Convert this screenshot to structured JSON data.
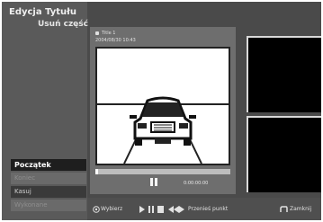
{
  "header": {
    "title": "Edycja Tytułu",
    "subtitle": "Usuń część"
  },
  "menu": {
    "items": [
      {
        "label": "Początek",
        "state": "active"
      },
      {
        "label": "Koniec",
        "state": "dim"
      },
      {
        "label": "Kasuj",
        "state": "normal"
      },
      {
        "label": "Wykonane",
        "state": "dim"
      }
    ]
  },
  "preview": {
    "title": "Title 1",
    "datetime": "2004/08/30 10:43",
    "timecode": "0:00:00:00",
    "progress": 0.02
  },
  "bottom_bar": {
    "select_label": "Wybierz",
    "nav_label": "Przenieś punkt",
    "back_label": "Zamknij"
  },
  "colors": {
    "background": "#4a4a4a",
    "sidebar": "#5a5a5a",
    "panel": "#6e6e6e",
    "active_item": "#1e1e1e"
  }
}
